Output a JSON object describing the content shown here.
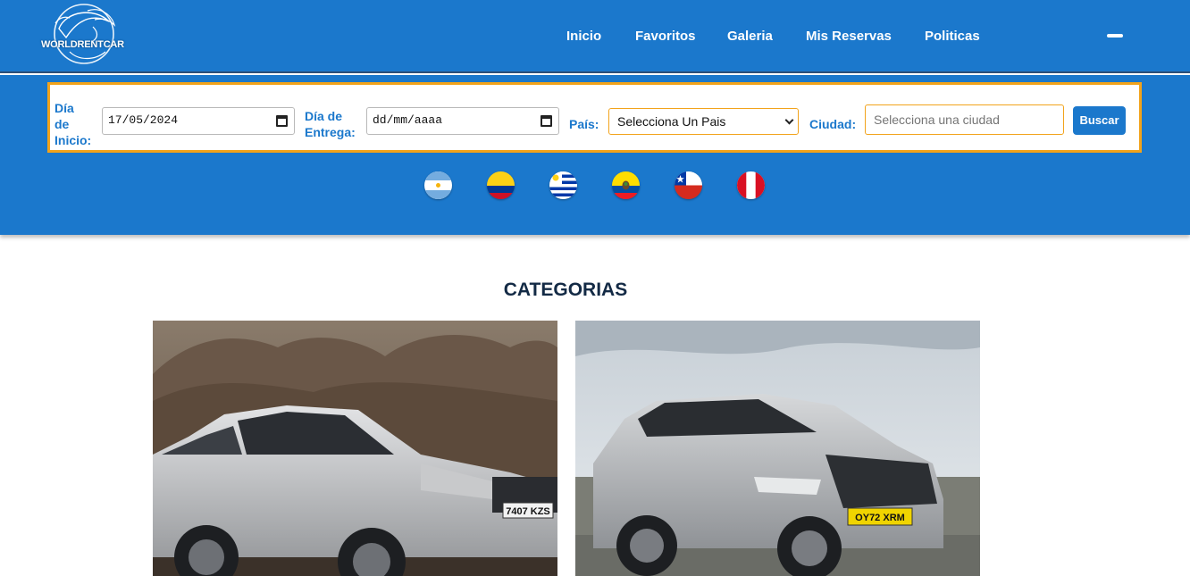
{
  "header": {
    "logo_text": "WORLDRENTCAR",
    "nav": [
      "Inicio",
      "Favoritos",
      "Galeria",
      "Mis Reservas",
      "Politicas"
    ]
  },
  "search": {
    "start_label_lines": [
      "Día",
      "de",
      "Inicio:"
    ],
    "start_value": "17/05/2024",
    "end_label_lines": [
      "Día de",
      "Entrega:"
    ],
    "end_value": "dd/mm/aaaa",
    "country_label": "País:",
    "country_selected": "Selecciona Un Pais",
    "city_label": "Ciudad:",
    "city_placeholder": "Selecciona una ciudad",
    "button_label": "Buscar"
  },
  "flags": [
    "argentina-flag-icon",
    "colombia-flag-icon",
    "uruguay-flag-icon",
    "ecuador-flag-icon",
    "chile-flag-icon",
    "peru-flag-icon"
  ],
  "categories": {
    "title": "CATEGORIAS",
    "cards": [
      {
        "plate": "7407 KZS"
      },
      {
        "plate": "OY72 XRM"
      }
    ]
  },
  "colors": {
    "brand_blue": "#1b78cc",
    "accent_orange": "#f2a31b",
    "title_navy": "#132a45"
  }
}
